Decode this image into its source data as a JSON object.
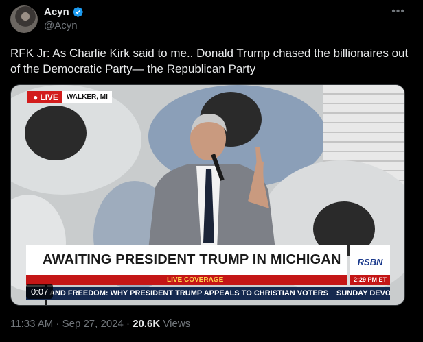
{
  "author": {
    "name": "Acyn",
    "handle": "@Acyn",
    "verified": true,
    "verified_color": "#1d9bf0"
  },
  "tweet": {
    "text": "RFK Jr: As Charlie Kirk said to me.. Donald Trump chased the billionaires out of the Democratic Party— the Republican Party"
  },
  "video": {
    "live_label": "LIVE",
    "location": "WALKER, MI",
    "banner": "AWAITING PRESIDENT TRUMP IN MICHIGAN",
    "coverage": "LIVE COVERAGE",
    "network": "RSBN",
    "time": "2:29 PM ET",
    "ticker_main": "AND FREEDOM: WHY PRESIDENT TRUMP APPEALS TO CHRISTIAN VOTERS",
    "ticker_next": "SUNDAY DEVOT",
    "duration": "0:07",
    "colors": {
      "live_red": "#d21c1c",
      "ticker_navy": "#15294f"
    }
  },
  "meta": {
    "time": "11:33 AM",
    "date": "Sep 27, 2024",
    "separator": "·",
    "views_count": "20.6K",
    "views_label": "Views"
  },
  "icons": {
    "more": "more-icon",
    "verified": "verified-badge-icon",
    "live": "live-dot-icon"
  }
}
